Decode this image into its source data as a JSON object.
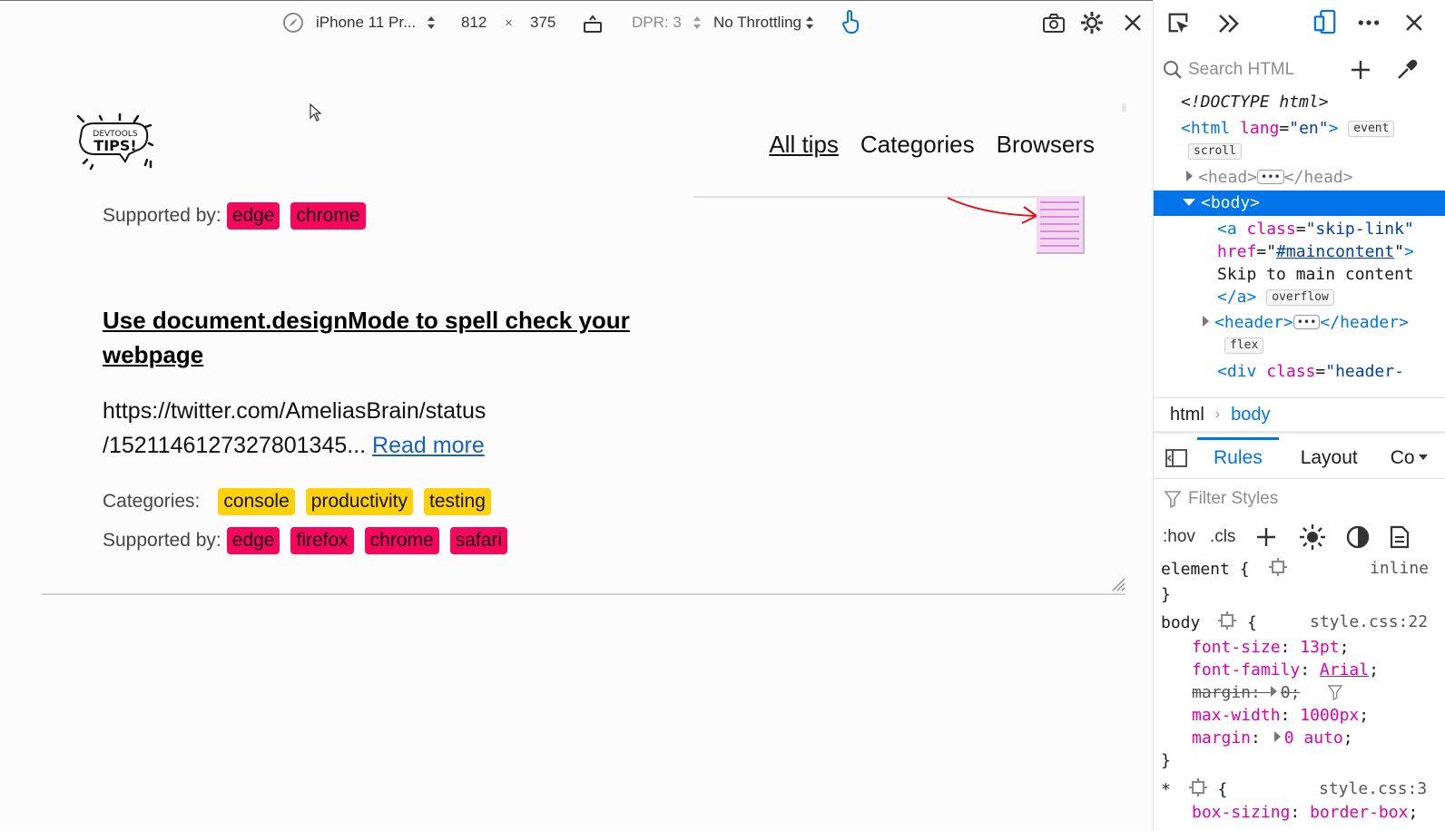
{
  "rdm_toolbar": {
    "device": "iPhone 11 Pr...",
    "width": "812",
    "times": "×",
    "height": "375",
    "dpr": "DPR: 3",
    "throttling": "No Throttling"
  },
  "site": {
    "logo_top": "DEVTOOLS",
    "logo_main": "TIPS!",
    "nav": [
      "All tips",
      "Categories",
      "Browsers"
    ]
  },
  "article_prev": {
    "supported_label": "Supported by:",
    "browsers": [
      "edge",
      "chrome"
    ]
  },
  "article": {
    "title": "Use document.designMode to spell check your webpage",
    "excerpt_line1": "https://twitter.com/AmeliasBrain/status",
    "excerpt_line2": "/1521146127327801345... ",
    "read_more": "Read more",
    "categories_label": "Categories:",
    "categories": [
      "console",
      "productivity",
      "testing"
    ],
    "supported_label": "Supported by:",
    "browsers": [
      "edge",
      "firefox",
      "chrome",
      "safari"
    ]
  },
  "devtools": {
    "search_placeholder": "Search HTML",
    "tree": {
      "doctype": "<!DOCTYPE html>",
      "html_tag": "html",
      "lang_attr": "lang",
      "lang_val": "\"en\"",
      "badge_event": "event",
      "badge_scroll": "scroll",
      "head_open": "<head>",
      "head_close": "</head>",
      "body_tag": "<body>",
      "a_open": "<a",
      "a_class_attr": "class",
      "a_class_val": "\"skip-link\"",
      "a_href_attr": "href",
      "a_href_val": "#maincontent",
      "a_text": "Skip to main content",
      "a_close": "</a>",
      "badge_overflow": "overflow",
      "header_open": "<header>",
      "header_close": "</header>",
      "badge_flex": "flex",
      "div_open": "<div",
      "div_class_attr": "class",
      "div_class_val": "\"header-"
    },
    "breadcrumbs": [
      "html",
      "body"
    ],
    "tabs": [
      "Rules",
      "Layout",
      "Co"
    ],
    "filter_placeholder": "Filter Styles",
    "rules_toolbar": {
      "hov": ":hov",
      "cls": ".cls"
    },
    "rules": {
      "element_selector": "element {",
      "element_source": "inline",
      "close_brace": "}",
      "body_selector": "body",
      "body_source": "style.css:22",
      "body_props": [
        {
          "name": "font-size",
          "value": "13pt"
        },
        {
          "name": "font-family",
          "value": "Arial"
        },
        {
          "name": "margin",
          "value": "0"
        },
        {
          "name": "max-width",
          "value": "1000px"
        },
        {
          "name": "margin",
          "value": "0 auto"
        }
      ],
      "star_selector": "*",
      "star_source": "style.css:3",
      "star_prop": {
        "name": "box-sizing",
        "value": "border-box"
      }
    }
  },
  "colors": {
    "browser_tag": "#f5075c",
    "category_tag": "#ffd10a",
    "devtools_accent": "#0074e8",
    "link": "#1660c2"
  },
  "icons": [
    "compass-icon",
    "sort-arrows-icon",
    "rotate-device-icon",
    "touch-icon",
    "screenshot-icon",
    "settings-gear-icon",
    "close-icon",
    "element-picker-icon",
    "chevron-double-right-icon",
    "responsive-mode-icon",
    "more-options-icon",
    "search-icon",
    "plus-icon",
    "eyedropper-icon",
    "sidebar-toggle-icon",
    "filter-icon",
    "light-theme-icon",
    "dark-theme-icon",
    "print-icon",
    "cursor-icon"
  ]
}
